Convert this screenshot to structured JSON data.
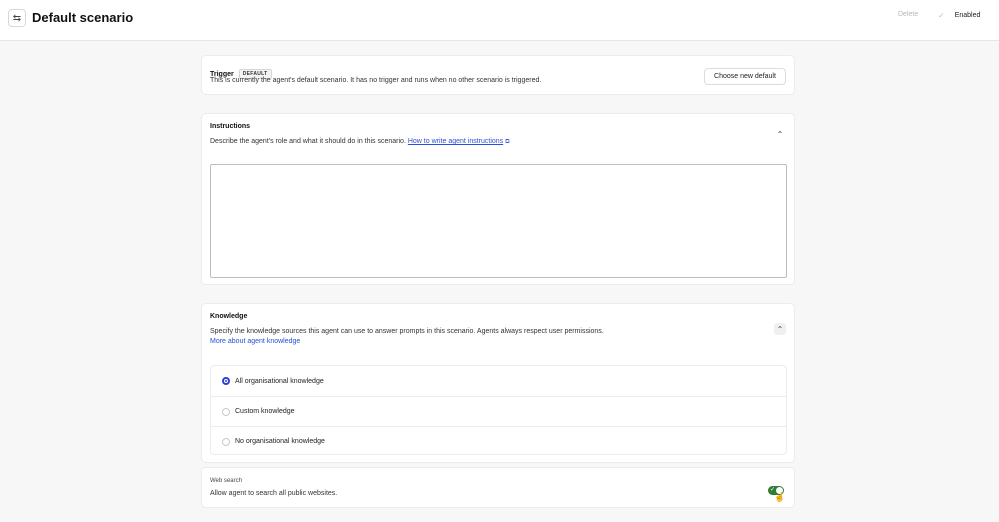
{
  "header": {
    "back_icon": "swap-arrows-icon",
    "back_glyph": "⇆",
    "title": "Default scenario",
    "delete_label": "Delete",
    "enabled_label": "Enabled",
    "enabled_check": "✓"
  },
  "trigger": {
    "title": "Trigger",
    "badge": "DEFAULT",
    "description": "This is currently the agent's default scenario. It has no trigger and runs when no other scenario is triggered.",
    "choose_label": "Choose new default"
  },
  "instructions": {
    "title": "Instructions",
    "description": "Describe the agent's role and what it should do in this scenario.",
    "link_text": "How to write agent instructions",
    "value": "",
    "collapse_glyph": "⌃"
  },
  "knowledge": {
    "title": "Knowledge",
    "description": "Specify the knowledge sources this agent can use to answer prompts in this scenario. Agents always respect user permissions.",
    "link_text": "More about agent knowledge",
    "collapse_glyph": "⌃",
    "options": [
      {
        "label": "All organisational knowledge",
        "selected": true
      },
      {
        "label": "Custom knowledge",
        "selected": false
      },
      {
        "label": "No organisational knowledge",
        "selected": false
      }
    ]
  },
  "web_search": {
    "title": "Web search",
    "description": "Allow agent to search all public websites.",
    "enabled": true,
    "toggle_check": "✓"
  },
  "colors": {
    "accent": "#2b3fd6",
    "link": "#2a4fd6",
    "toggle_on": "#2f7d32"
  }
}
